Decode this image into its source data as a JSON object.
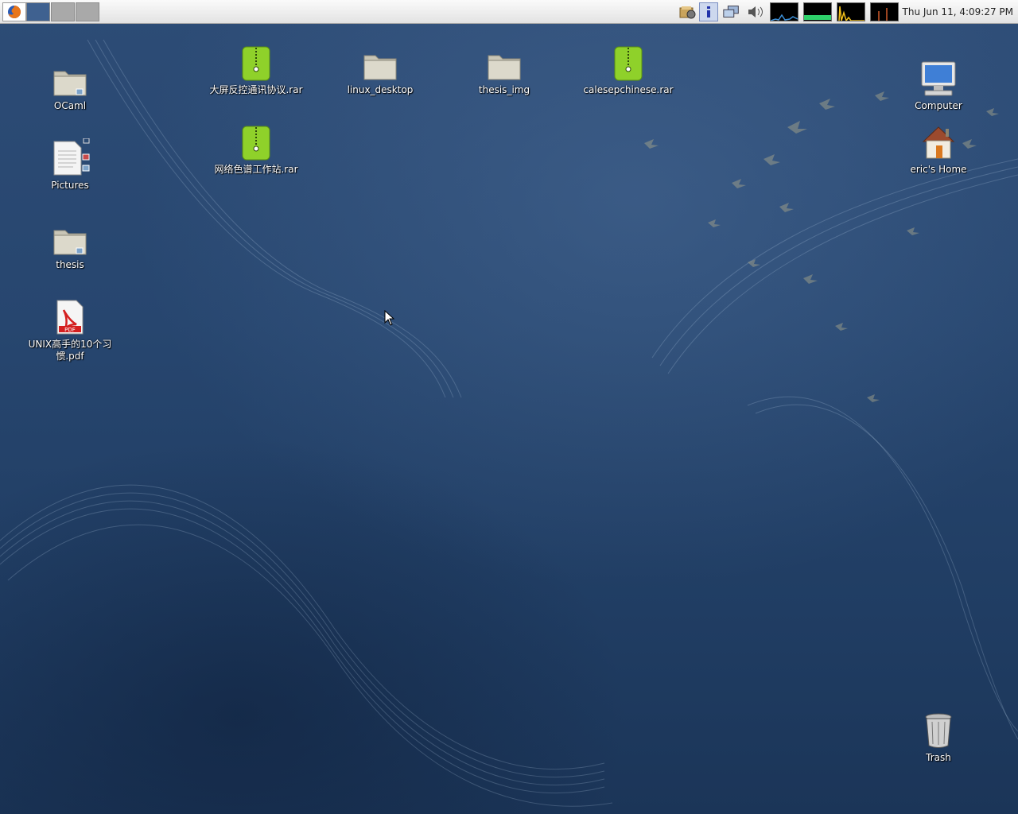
{
  "panel": {
    "launcher": "firefox-icon",
    "workspaces": [
      "workspace-1",
      "workspace-2",
      "workspace-3"
    ],
    "tray": [
      "update-notifier-icon",
      "info-icon",
      "network-icon",
      "volume-icon"
    ],
    "monitors": [
      "cpu-monitor",
      "memory-monitor",
      "network-monitor",
      "load-monitor"
    ],
    "clock": "Thu Jun 11,  4:09:27 PM"
  },
  "desktop": {
    "left_column": [
      {
        "label": "OCaml",
        "icon": "folder-icon"
      },
      {
        "label": "Pictures",
        "icon": "document-icon"
      },
      {
        "label": "thesis",
        "icon": "folder-icon"
      },
      {
        "label": "UNIX高手的10个习惯.pdf",
        "icon": "pdf-icon"
      }
    ],
    "top_row": [
      {
        "label": "大屏反控通讯协议.rar",
        "icon": "archive-icon"
      },
      {
        "label": "linux_desktop",
        "icon": "folder-icon"
      },
      {
        "label": "thesis_img",
        "icon": "folder-icon"
      },
      {
        "label": "calesepchinese.rar",
        "icon": "archive-icon"
      },
      {
        "label": "网络色谱工作站.rar",
        "icon": "archive-icon"
      }
    ],
    "right_column": [
      {
        "label": "Computer",
        "icon": "computer-icon"
      },
      {
        "label": "eric's Home",
        "icon": "home-icon"
      },
      {
        "label": "Trash",
        "icon": "trash-icon"
      }
    ]
  },
  "colors": {
    "wallpaper": "#27466f",
    "archive_green": "#8fd12a",
    "panel": "#ececec"
  }
}
